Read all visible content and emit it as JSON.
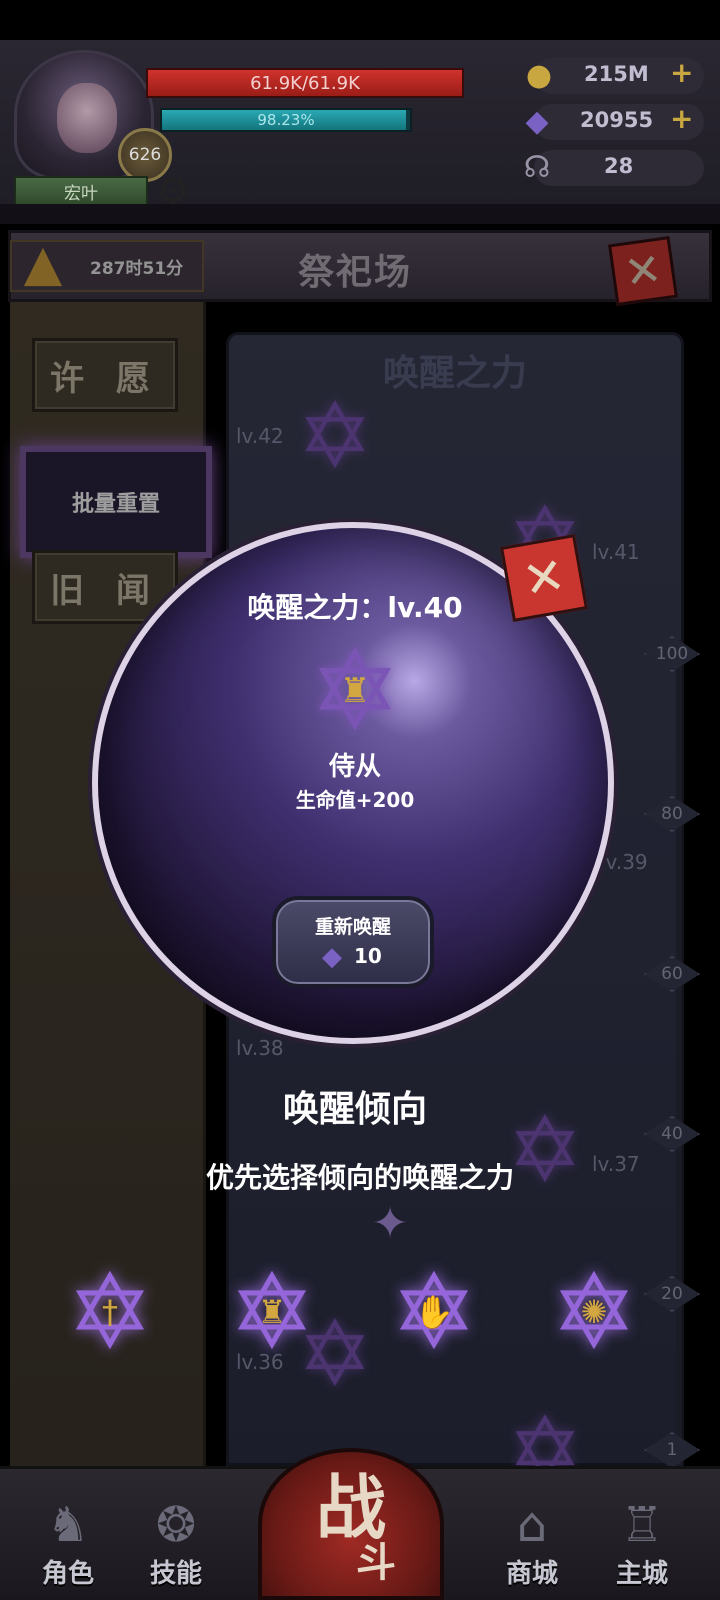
{
  "player": {
    "name": "宏叶",
    "level": "626",
    "hp_text": "61.9K/61.9K",
    "hp_fraction": 1.0,
    "xp_text": "98.23%",
    "xp_fraction": 0.9823
  },
  "resources": {
    "gold": "215M",
    "crystal": "20955",
    "horn": "28"
  },
  "title_bar": {
    "timer": "287时51分",
    "title": "祭祀场"
  },
  "side_menu": {
    "wish": "许 愿",
    "batch_reset": "批量重置",
    "old_news": "旧 闻"
  },
  "scroll": {
    "title": "唤醒之力",
    "levels": [
      "lv.42",
      "lv.41",
      "lv.39",
      "lv.38",
      "lv.37",
      "lv.36"
    ],
    "milestones": [
      "100",
      "80",
      "60",
      "40",
      "20",
      "1"
    ]
  },
  "awaken_popup": {
    "title": "唤醒之力：lv.40",
    "name": "侍从",
    "effect": "生命值+200",
    "button_label": "重新唤醒",
    "cost": "10"
  },
  "bias": {
    "title": "唤醒倾向",
    "subtitle": "优先选择倾向的唤醒之力"
  },
  "bottom_nav": {
    "role": "角色",
    "skill": "技能",
    "fight_main": "战",
    "fight_sub": "斗",
    "shop": "商城",
    "city": "主城"
  },
  "colors": {
    "hp": "#d0322c",
    "xp": "#2aa9b3",
    "accent_purple": "#7b55b5",
    "close_red": "#c8362f",
    "gold": "#c8a640"
  }
}
